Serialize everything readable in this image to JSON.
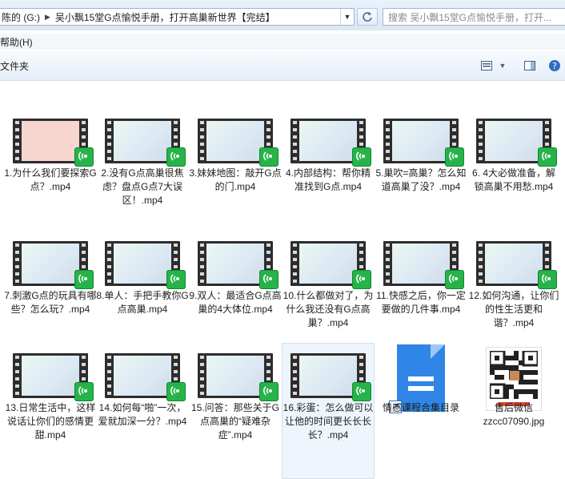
{
  "address": {
    "segments": [
      "陈的 (G:)",
      "吴小飘15堂G点愉悦手册，打开高巢新世界【完结】"
    ],
    "search_placeholder": "搜索 吴小飘15堂G点愉悦手册，打开..."
  },
  "menu": {
    "help": "帮助(H)"
  },
  "toolbar": {
    "crumb": "文件夹"
  },
  "files": [
    {
      "label": "1.为什么我们要探索G点？.mp4",
      "type": "video",
      "thumb": "pink"
    },
    {
      "label": "2.没有G点高巢很焦虑？盘点G点7大误区！.mp4",
      "type": "video"
    },
    {
      "label": "3.妹妹地图：敲开G点的门.mp4",
      "type": "video"
    },
    {
      "label": "4.内部结构：帮你精准找到G点.mp4",
      "type": "video"
    },
    {
      "label": "5.巢吹=高巢？怎么知道高巢了没？.mp4",
      "type": "video"
    },
    {
      "label": "6. 4大必做准备，解锁高巢不用愁.mp4",
      "type": "video"
    },
    {
      "label": "7.刺激G点的玩具有哪些？怎么玩？.mp4",
      "type": "video"
    },
    {
      "label": "8.单人：手把手教你G点高巢.mp4",
      "type": "video"
    },
    {
      "label": "9.双人：最适合G点高巢的4大体位.mp4",
      "type": "video"
    },
    {
      "label": "10.什么都做对了，为什么我还没有G点高巢？.mp4",
      "type": "video"
    },
    {
      "label": "11.快感之后，你一定要做的几件事.mp4",
      "type": "video"
    },
    {
      "label": "12.如何沟通，让你们的性生活更和谐？.mp4",
      "type": "video"
    },
    {
      "label": "13.日常生活中，这样说话让你们的感情更甜.mp4",
      "type": "video"
    },
    {
      "label": "14.如何每“啪”一次，爱就加深一分？.mp4",
      "type": "video"
    },
    {
      "label": "15.问答：那些关于G点高巢的“疑难杂症”.mp4",
      "type": "video"
    },
    {
      "label": "16.彩蛋：怎么做可以让他的时间更长长长长？.mp4",
      "type": "video",
      "selected": true
    },
    {
      "label": "情感课程合集目录",
      "type": "doc"
    },
    {
      "label": "售后微信zzcc07090.jpg",
      "type": "image"
    }
  ]
}
